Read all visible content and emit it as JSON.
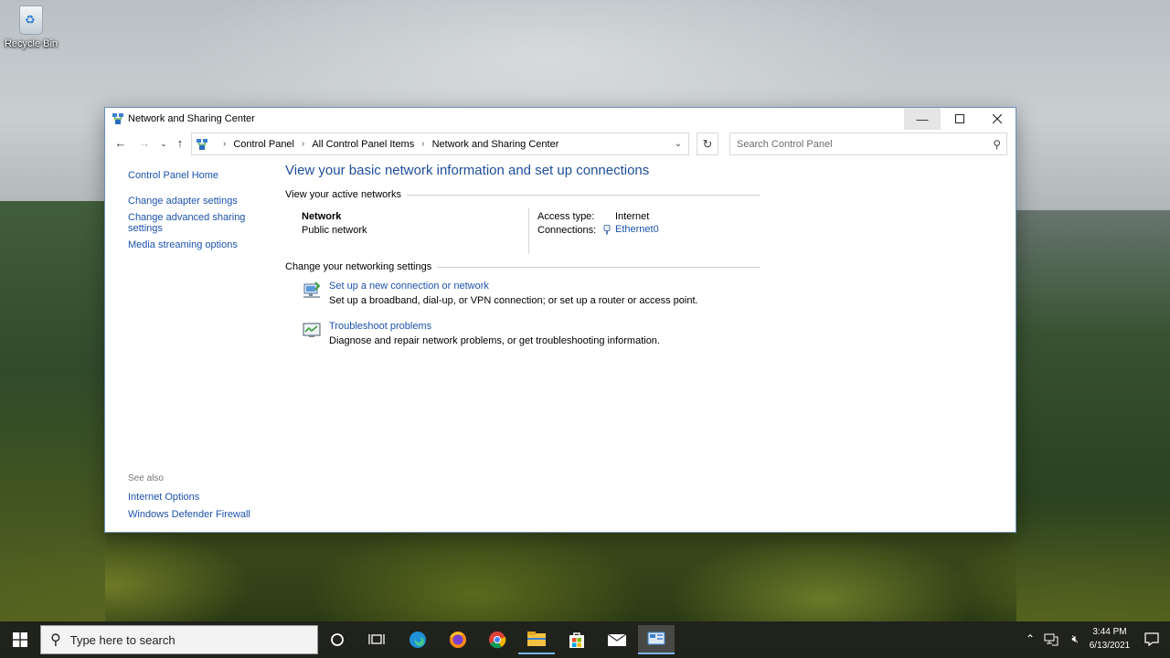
{
  "desktop": {
    "recycle_bin_label": "Recycle Bin"
  },
  "window": {
    "title": "Network and Sharing Center",
    "breadcrumb": [
      "Control Panel",
      "All Control Panel Items",
      "Network and Sharing Center"
    ],
    "search_placeholder": "Search Control Panel"
  },
  "sidebar": {
    "home": "Control Panel Home",
    "items": [
      {
        "label": "Change adapter settings"
      },
      {
        "label": "Change advanced sharing settings"
      },
      {
        "label": "Media streaming options"
      }
    ],
    "see_also_header": "See also",
    "see_also": [
      {
        "label": "Internet Options"
      },
      {
        "label": "Windows Defender Firewall"
      }
    ]
  },
  "main": {
    "heading": "View your basic network information and set up connections",
    "active_networks_header": "View your active networks",
    "network": {
      "name": "Network",
      "type": "Public network",
      "access_type_label": "Access type:",
      "access_type_value": "Internet",
      "connections_label": "Connections:",
      "connections_value": "Ethernet0"
    },
    "change_settings_header": "Change your networking settings",
    "tasks": [
      {
        "title": "Set up a new connection or network",
        "description": "Set up a broadband, dial-up, or VPN connection; or set up a router or access point.",
        "icon": "new-connection-icon"
      },
      {
        "title": "Troubleshoot problems",
        "description": "Diagnose and repair network problems, or get troubleshooting information.",
        "icon": "troubleshoot-icon"
      }
    ]
  },
  "taskbar": {
    "search_placeholder": "Type here to search",
    "time": "3:44 PM",
    "date": "6/13/2021",
    "pinned": [
      "cortana-icon",
      "task-view-icon",
      "edge-icon",
      "firefox-icon",
      "chrome-icon",
      "file-explorer-icon",
      "store-icon",
      "mail-icon",
      "control-panel-icon"
    ]
  },
  "colors": {
    "link": "#1c53ac",
    "heading": "#1e4e9a",
    "taskbar": "#1e201c"
  }
}
